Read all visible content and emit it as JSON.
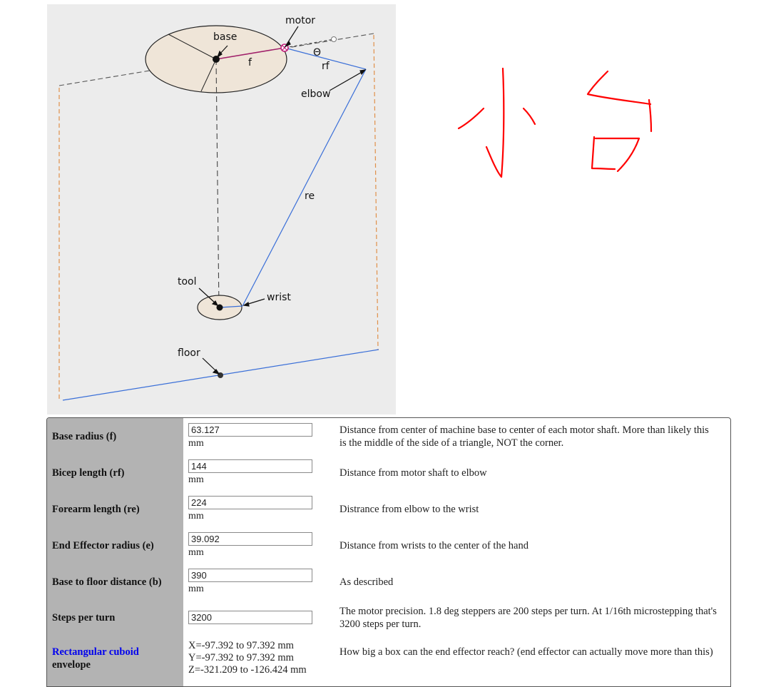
{
  "diagram": {
    "labels": {
      "motor": "motor",
      "base": "base",
      "f": "f",
      "theta": "Θ",
      "rf": "rf",
      "elbow": "elbow",
      "re": "re",
      "tool": "tool",
      "wrist": "wrist",
      "floor": "floor"
    }
  },
  "annotation": {
    "text": "小白",
    "color": "#ff0000"
  },
  "colors": {
    "arm_line": "#3a6fd8",
    "base_line": "#a0206a",
    "envelope_dash": "#e0904a",
    "platform_fill": "#efe5d8",
    "label_column": "#b3b3b3"
  },
  "params": [
    {
      "label": "Base radius (f)",
      "value": "63.127",
      "unit": "mm",
      "description": "Distance from center of machine base to center of each motor shaft. More than likely this is the middle of the side of a triangle, NOT the corner."
    },
    {
      "label": "Bicep length (rf)",
      "value": "144",
      "unit": "mm",
      "description": "Distance from motor shaft to elbow"
    },
    {
      "label": "Forearm length (re)",
      "value": "224",
      "unit": "mm",
      "description": "Distrance from elbow to the wrist"
    },
    {
      "label": "End Effector radius (e)",
      "value": "39.092",
      "unit": "mm",
      "description": "Distance from wrists to the center of the hand"
    },
    {
      "label": "Base to floor distance (b)",
      "value": "390",
      "unit": "mm",
      "description": "As described"
    },
    {
      "label": "Steps per turn",
      "value": "3200",
      "unit": "",
      "description": "The motor precision. 1.8 deg steppers are 200 steps per turn. At 1/16th microstepping that's 3200 steps per turn."
    }
  ],
  "envelope": {
    "link_label": "Rectangular cuboid",
    "label_rest": "envelope",
    "x_range": "X=-97.392 to 97.392 mm",
    "y_range": "Y=-97.392 to 97.392 mm",
    "z_range": "Z=-321.209 to -126.424 mm",
    "description": "How big a box can the end effector reach? (end effector can actually move more than this)"
  }
}
